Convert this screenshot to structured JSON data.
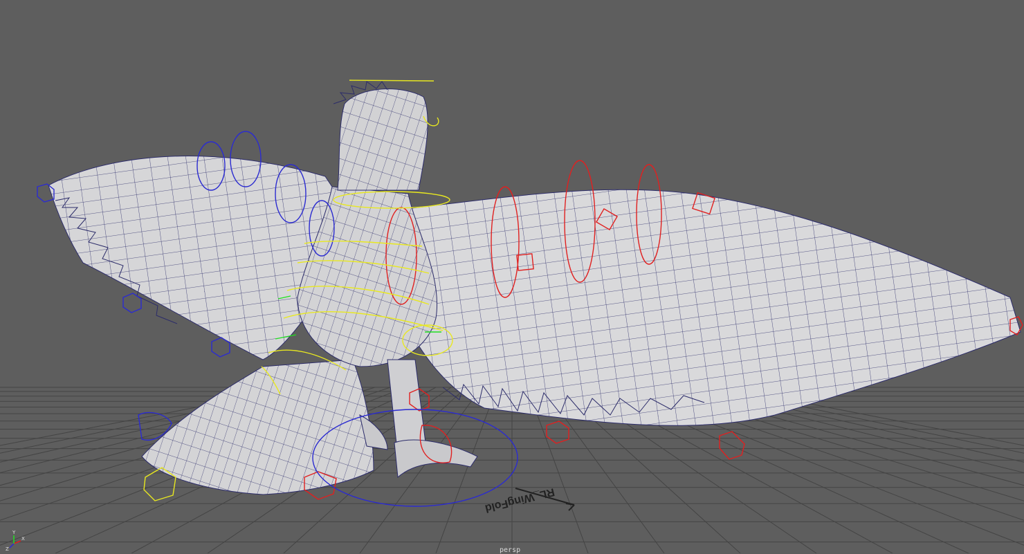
{
  "viewport": {
    "camera_name": "persp",
    "background_color": "#5e5e5e",
    "grid_color": "#3c3c3c",
    "mesh_fill": "#d7d7d9",
    "wire_color": "#2c2c6a",
    "ground_annotation": "RL_WingFold",
    "axis_labels": {
      "x": "X",
      "y": "Y",
      "z": "Z"
    }
  }
}
